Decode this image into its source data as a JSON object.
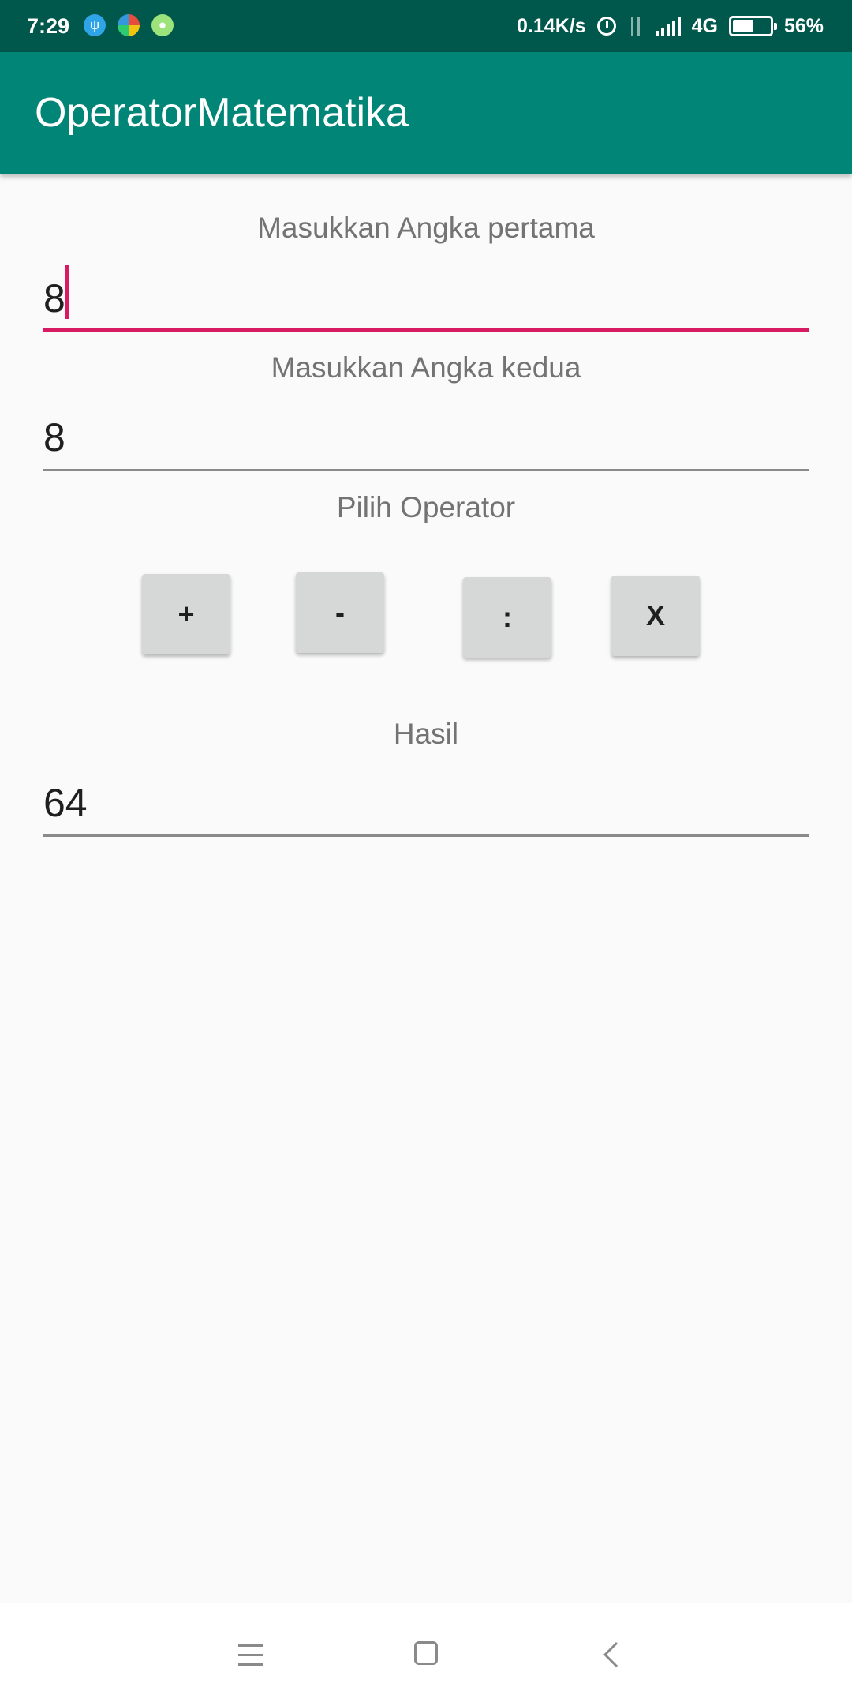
{
  "status_bar": {
    "time": "7:29",
    "network_speed": "0.14K/s",
    "network_type": "4G",
    "battery": "56%",
    "battery_level": 0.56,
    "notification_icons": [
      "usb-debug-icon",
      "pinwheel-app-icon",
      "android-icon"
    ],
    "status_icons": [
      "alarm-icon",
      "data-transfer-icon",
      "signal-icon",
      "battery-icon"
    ]
  },
  "app_bar": {
    "title": "OperatorMatematika",
    "color": "#008577"
  },
  "form": {
    "first_number": {
      "label": "Masukkan Angka pertama",
      "value": "8",
      "focused": true
    },
    "second_number": {
      "label": "Masukkan Angka kedua",
      "value": "8"
    },
    "operator_label": "Pilih Operator",
    "operators": {
      "add": "+",
      "subtract": "-",
      "divide": ":",
      "multiply": "X"
    },
    "result": {
      "label": "Hasil",
      "value": "64"
    },
    "accent_color": "#d81b60"
  },
  "nav_bar": {
    "icons": [
      "menu-icon",
      "home-icon",
      "back-icon"
    ]
  }
}
